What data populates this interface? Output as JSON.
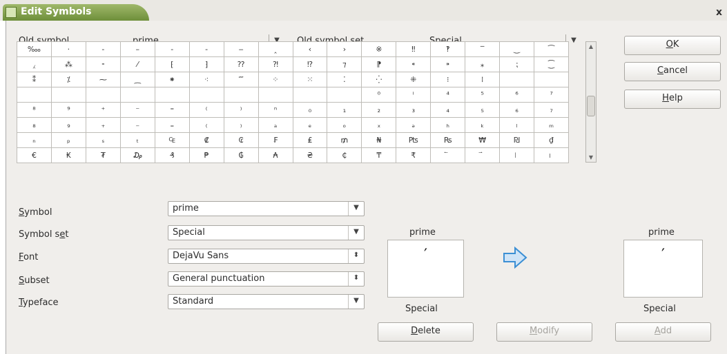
{
  "window": {
    "title": "Edit Symbols",
    "close": "x"
  },
  "old_symbol": {
    "label_pre": "",
    "label_u": "O",
    "label_post": "ld symbol",
    "value": "prime"
  },
  "old_symbol_set": {
    "label_pre": "O",
    "label_u": "l",
    "label_post": "d symbol set",
    "value": "Special"
  },
  "buttons": {
    "ok_u": "O",
    "ok_post": "K",
    "cancel_u": "C",
    "cancel_post": "ancel",
    "help_u": "H",
    "help_post": "elp",
    "delete_u": "D",
    "delete_post": "elete",
    "modify_u": "M",
    "modify_post": "odify",
    "add_u": "A",
    "add_post": "dd"
  },
  "symbol_grid": [
    [
      "‱",
      "·",
      "-",
      "–",
      "‐",
      "‑",
      "‒",
      "‸",
      "‹",
      "›",
      "※",
      "‼",
      "‽",
      "‾",
      "‿",
      "⁀"
    ],
    [
      "⁁",
      "⁂",
      "⁃",
      "⁄",
      "⁅",
      "⁆",
      "⁇",
      "⁈",
      "⁉",
      "⁊",
      "⁋",
      "⁌",
      "⁍",
      "⁎",
      "⁏",
      "⁐"
    ],
    [
      "⁑",
      "⁒",
      "⁓",
      "⁔",
      "⁕",
      "⁖",
      "⁗",
      "⁘",
      "⁙",
      "⁚",
      "⁛",
      "⁜",
      "⁝",
      "⁞",
      "",
      ""
    ],
    [
      "",
      "",
      "",
      "",
      "",
      "",
      "",
      "",
      "",
      "",
      "⁰",
      "ⁱ",
      "⁴",
      "⁵",
      "⁶",
      "⁷"
    ],
    [
      "⁸",
      "⁹",
      "⁺",
      "⁻",
      "⁼",
      "⁽",
      "⁾",
      "ⁿ",
      "₀",
      "₁",
      "₂",
      "₃",
      "₄",
      "₅",
      "₆",
      "₇"
    ],
    [
      "₈",
      "₉",
      "₊",
      "₋",
      "₌",
      "₍",
      "₎",
      "ₐ",
      "ₑ",
      "ₒ",
      "ₓ",
      "ₔ",
      "ₕ",
      "ₖ",
      "ₗ",
      "ₘ"
    ],
    [
      "ₙ",
      "ₚ",
      "ₛ",
      "ₜ",
      "₠",
      "₡",
      "₢",
      "₣",
      "₤",
      "₥",
      "₦",
      "₧",
      "₨",
      "₩",
      "₪",
      "₫"
    ],
    [
      "€",
      "₭",
      "₮",
      "₯",
      "₰",
      "₱",
      "₲",
      "₳",
      "₴",
      "₵",
      "₸",
      "₹",
      "⃐",
      "⃑",
      "⃒",
      "⃓"
    ]
  ],
  "fields": {
    "symbol": {
      "label_u": "S",
      "label_post": "ymbol",
      "value": "prime"
    },
    "symbol_set": {
      "label_pre": "Symbol s",
      "label_u": "e",
      "label_post": "t",
      "value": "Special"
    },
    "font": {
      "label_u": "F",
      "label_post": "ont",
      "value": "DejaVu Sans"
    },
    "subset": {
      "label_u": "S",
      "label_post": "ubset",
      "value": "General punctuation"
    },
    "typeface": {
      "label_u": "T",
      "label_post": "ypeface",
      "value": "Standard"
    }
  },
  "preview_old": {
    "name": "prime",
    "glyph": "′",
    "set": "Special"
  },
  "preview_new": {
    "name": "prime",
    "glyph": "′",
    "set": "Special"
  },
  "arrow_icon": {
    "name": "right-arrow-icon",
    "color": "#3b8fd4"
  },
  "combo_arrow": "▼",
  "spin_arrow": "⬍"
}
